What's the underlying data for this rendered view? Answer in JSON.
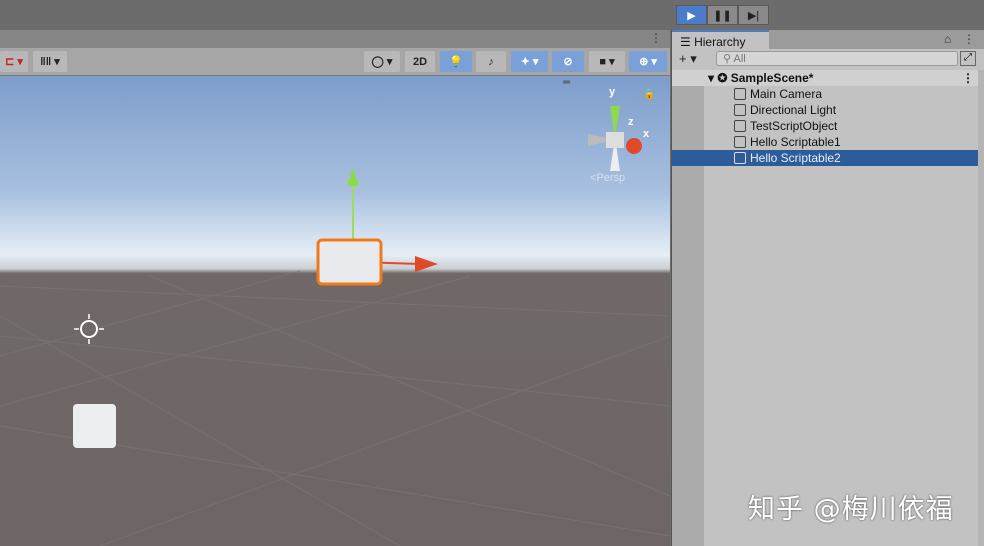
{
  "play_controls": {
    "play": "▶",
    "pause": "❚❚",
    "step": "▶|"
  },
  "scene_toolbar": {
    "two_d": "2D",
    "kebab": "⋮"
  },
  "gizmo": {
    "y": "y",
    "z": "z",
    "x": "x",
    "projection": "<Persp"
  },
  "hierarchy": {
    "tab": "Hierarchy",
    "add": "+ ▾",
    "search_placeholder": "All",
    "scene": "SampleScene*",
    "items": [
      {
        "label": "Main Camera",
        "selected": false
      },
      {
        "label": "Directional Light",
        "selected": false
      },
      {
        "label": "TestScriptObject",
        "selected": false
      },
      {
        "label": "Hello Scriptable1",
        "selected": false
      },
      {
        "label": "Hello Scriptable2",
        "selected": true
      }
    ]
  },
  "watermark": "知乎 @梅川依福",
  "colors": {
    "accent": "#4a7cc9",
    "selection": "#2c5d9a"
  }
}
